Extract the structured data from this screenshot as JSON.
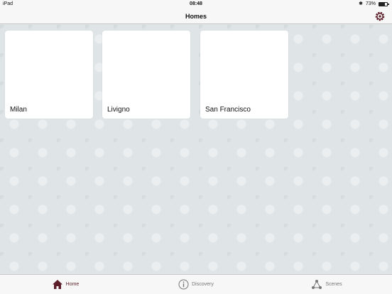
{
  "status_bar": {
    "device": "iPad",
    "time": "08:48",
    "battery": "73%",
    "battery_level": 0.73
  },
  "nav": {
    "title": "Homes",
    "settings_icon": "gear-icon"
  },
  "homes": [
    {
      "name": "Milan"
    },
    {
      "name": "Livigno"
    },
    {
      "name": "San Francisco"
    }
  ],
  "tabs": [
    {
      "label": "Home",
      "icon": "house-icon",
      "active": true
    },
    {
      "label": "Discovery",
      "icon": "info-icon",
      "active": false
    },
    {
      "label": "Scenes",
      "icon": "network-icon",
      "active": false
    }
  ],
  "colors": {
    "accent": "#5c1f2a",
    "background": "#dfe5e7"
  }
}
